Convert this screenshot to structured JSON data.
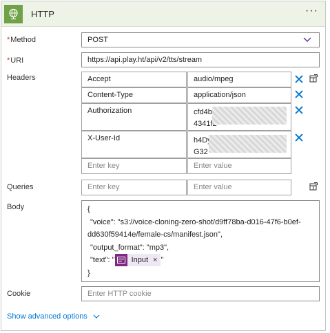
{
  "header": {
    "title": "HTTP",
    "more_label": "···"
  },
  "method": {
    "label": "Method",
    "value": "POST"
  },
  "uri": {
    "label": "URI",
    "value": "https://api.play.ht/api/v2/tts/stream"
  },
  "headers": {
    "label": "Headers",
    "rows": [
      {
        "key": "Accept",
        "value": "audio/mpeg"
      },
      {
        "key": "Content-Type",
        "value": "application/json"
      },
      {
        "key": "Authorization",
        "value_line1": "cfd4b",
        "value_line2": "4341f2"
      },
      {
        "key": "X-User-Id",
        "value_line1": "h4Dy",
        "value_line2": "G32"
      }
    ],
    "key_placeholder": "Enter key",
    "value_placeholder": "Enter value"
  },
  "queries": {
    "label": "Queries",
    "key_placeholder": "Enter key",
    "value_placeholder": "Enter value"
  },
  "body": {
    "label": "Body",
    "line1": "{",
    "line2": "\"voice\": \"s3://voice-cloning-zero-shot/d9ff78ba-d016-47f6-b0ef-",
    "line3": "dd630f59414e/female-cs/manifest.json\",",
    "line4": "\"output_format\": \"mp3\",",
    "line5_prefix": "\"text\": \"",
    "token_label": "Input",
    "token_close": "×",
    "line5_suffix": "\"",
    "line6": "}"
  },
  "cookie": {
    "label": "Cookie",
    "placeholder": "Enter HTTP cookie"
  },
  "advanced": {
    "label": "Show advanced options"
  },
  "colors": {
    "accent": "#0078d4",
    "header_bg": "#edf3e6",
    "logo_bg": "#70a148",
    "token_bg": "#eee7f4",
    "token_icon_bg": "#7e2a82",
    "required": "#d13438"
  }
}
